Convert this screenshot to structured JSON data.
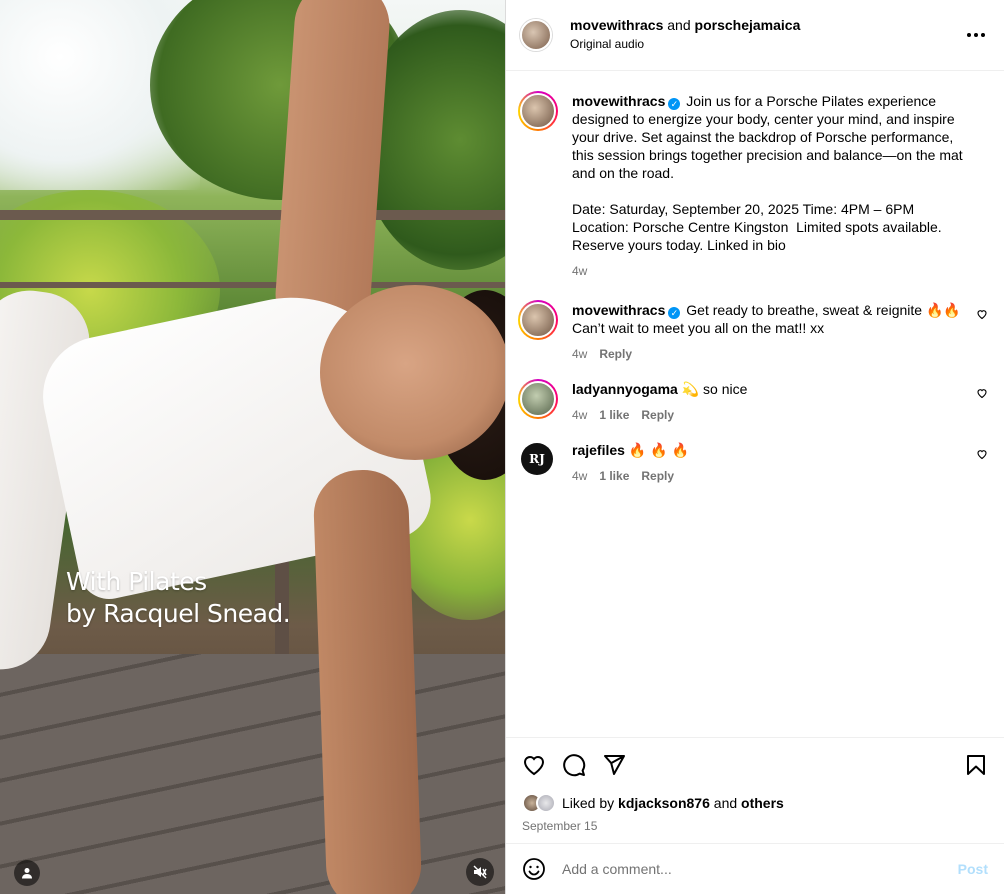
{
  "media": {
    "overlay_line1": "With Pilates",
    "overlay_line2": "by Racquel Snead.",
    "user_tag_icon": "person-icon",
    "mute_icon": "speaker-muted-icon"
  },
  "header": {
    "username": "movewithracs",
    "and_text": "and",
    "collab_username": "porschejamaica",
    "audio": "Original audio",
    "more_icon": "more-horizontal-icon"
  },
  "caption": {
    "username": "movewithracs",
    "text": "Join us for a Porsche Pilates experience designed to energize your body, center your mind, and inspire your drive. Set against the backdrop of Porsche performance, this session brings together precision and balance—on the mat and on the road.\n\nDate: Saturday, September 20, 2025 Time: 4PM – 6PM Location: Porsche Centre Kingston  Limited spots available. Reserve yours today. Linked in bio",
    "time": "4w"
  },
  "comments": [
    {
      "username": "movewithracs",
      "verified": true,
      "text": "Get ready to breathe, sweat & reignite 🔥🔥 Can’t wait to meet you all on the mat!! xx",
      "time": "4w",
      "likes": "",
      "reply": "Reply"
    },
    {
      "username": "ladyannyogama",
      "verified": false,
      "text": "💫 so nice",
      "time": "4w",
      "likes": "1 like",
      "reply": "Reply"
    },
    {
      "username": "rajefiles",
      "verified": false,
      "avatar_text": "RJ",
      "text": "🔥 🔥 🔥",
      "time": "4w",
      "likes": "1 like",
      "reply": "Reply"
    }
  ],
  "actions": {
    "like_icon": "heart-icon",
    "comment_icon": "comment-bubble-icon",
    "share_icon": "send-paper-plane-icon",
    "save_icon": "bookmark-icon"
  },
  "likes": {
    "prefix": "Liked by",
    "user": "kdjackson876",
    "and_text": "and",
    "others": "others"
  },
  "date": "September 15",
  "add_comment": {
    "placeholder": "Add a comment...",
    "post_label": "Post",
    "emoji_icon": "emoji-smile-icon"
  },
  "colors": {
    "link_blue": "#0095f6",
    "post_disabled": "#b2dffc",
    "secondary_text": "#737373"
  }
}
